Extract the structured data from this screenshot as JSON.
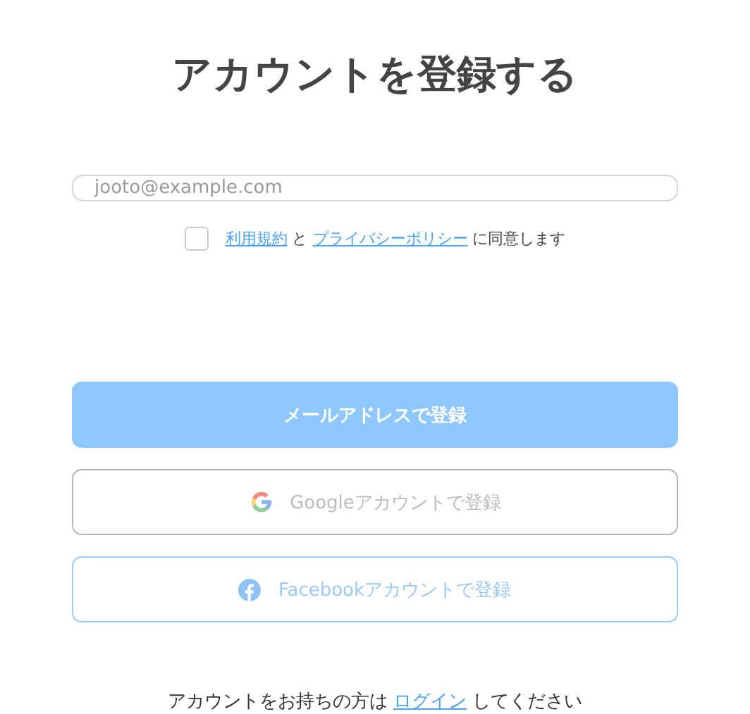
{
  "title": "アカウントを登録する",
  "email": {
    "placeholder": "jooto@example.com"
  },
  "agreement": {
    "checked": false,
    "terms_link": "利用規約",
    "and": "と",
    "privacy_link": "プライバシーポリシー",
    "suffix": "に同意します"
  },
  "buttons": [
    {
      "kind": "email",
      "label": "メールアドレスで登録"
    },
    {
      "kind": "google",
      "label": "Googleアカウントで登録"
    },
    {
      "kind": "facebook",
      "label": "Facebookアカウントで登録"
    }
  ],
  "footer": {
    "prefix": "アカウントをお持ちの方は",
    "link": "ログイン",
    "suffix": "してください"
  }
}
